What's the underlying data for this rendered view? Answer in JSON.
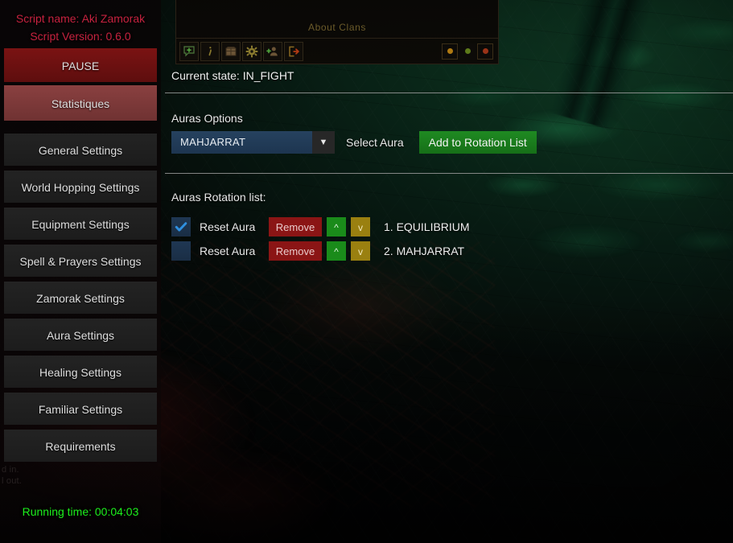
{
  "sidebar": {
    "script_name": "Script name: Aki Zamorak",
    "script_version": "Script Version: 0.6.0",
    "pause_label": "PAUSE",
    "statistics_label": "Statistiques",
    "nav_items": [
      {
        "label": "General Settings"
      },
      {
        "label": "World Hopping Settings"
      },
      {
        "label": "Equipment Settings"
      },
      {
        "label": "Spell & Prayers Settings"
      },
      {
        "label": "Zamorak Settings"
      },
      {
        "label": "Aura Settings"
      },
      {
        "label": "Healing Settings"
      },
      {
        "label": "Familiar Settings"
      },
      {
        "label": "Requirements"
      }
    ],
    "running_time": "Running time: 00:04:03"
  },
  "clan_window": {
    "title": "About Clans",
    "toolbar_icons": [
      {
        "name": "chat-add-icon"
      },
      {
        "name": "info-icon"
      },
      {
        "name": "chest-icon"
      },
      {
        "name": "gear-icon"
      },
      {
        "name": "add-friend-icon"
      },
      {
        "name": "logout-icon"
      }
    ],
    "status_dots": [
      {
        "name": "status-dot-orange",
        "color": "#b07a12"
      },
      {
        "name": "status-dot-green",
        "color": "#5d7a1a"
      },
      {
        "name": "status-dot-red",
        "color": "#9a3318"
      }
    ]
  },
  "main": {
    "current_state": "Current state: IN_FIGHT",
    "auras_options_label": "Auras Options",
    "aura_select_value": "MAHJARRAT",
    "aura_select_caption": "Select Aura",
    "add_to_rotation_label": "Add to Rotation List",
    "rotation_list_label": "Auras Rotation list:",
    "rotation_rows": [
      {
        "checked": true,
        "reset_label": "Reset Aura",
        "remove_label": "Remove",
        "up_label": "^",
        "down_label": "v",
        "name": "1. EQUILIBRIUM"
      },
      {
        "checked": false,
        "reset_label": "Reset Aura",
        "remove_label": "Remove",
        "up_label": "^",
        "down_label": "v",
        "name": "2. MAHJARRAT"
      }
    ]
  },
  "background_chat": {
    "line1": "d in.",
    "line2": "l out."
  },
  "colors": {
    "script_text": "#c6223f",
    "pause_button": "#6e1212",
    "statistics_button": "#7d3a3a",
    "nav_button": "#202020",
    "running_time": "#1cf01c",
    "accent_green": "#1f8a22",
    "remove_red": "#8b1515",
    "up_green": "#1a8b1a",
    "down_yellow": "#9a8010",
    "combo_blue": "#26425f",
    "check_blue": "#2f8fdf",
    "clan_title": "#6b5a2a"
  }
}
